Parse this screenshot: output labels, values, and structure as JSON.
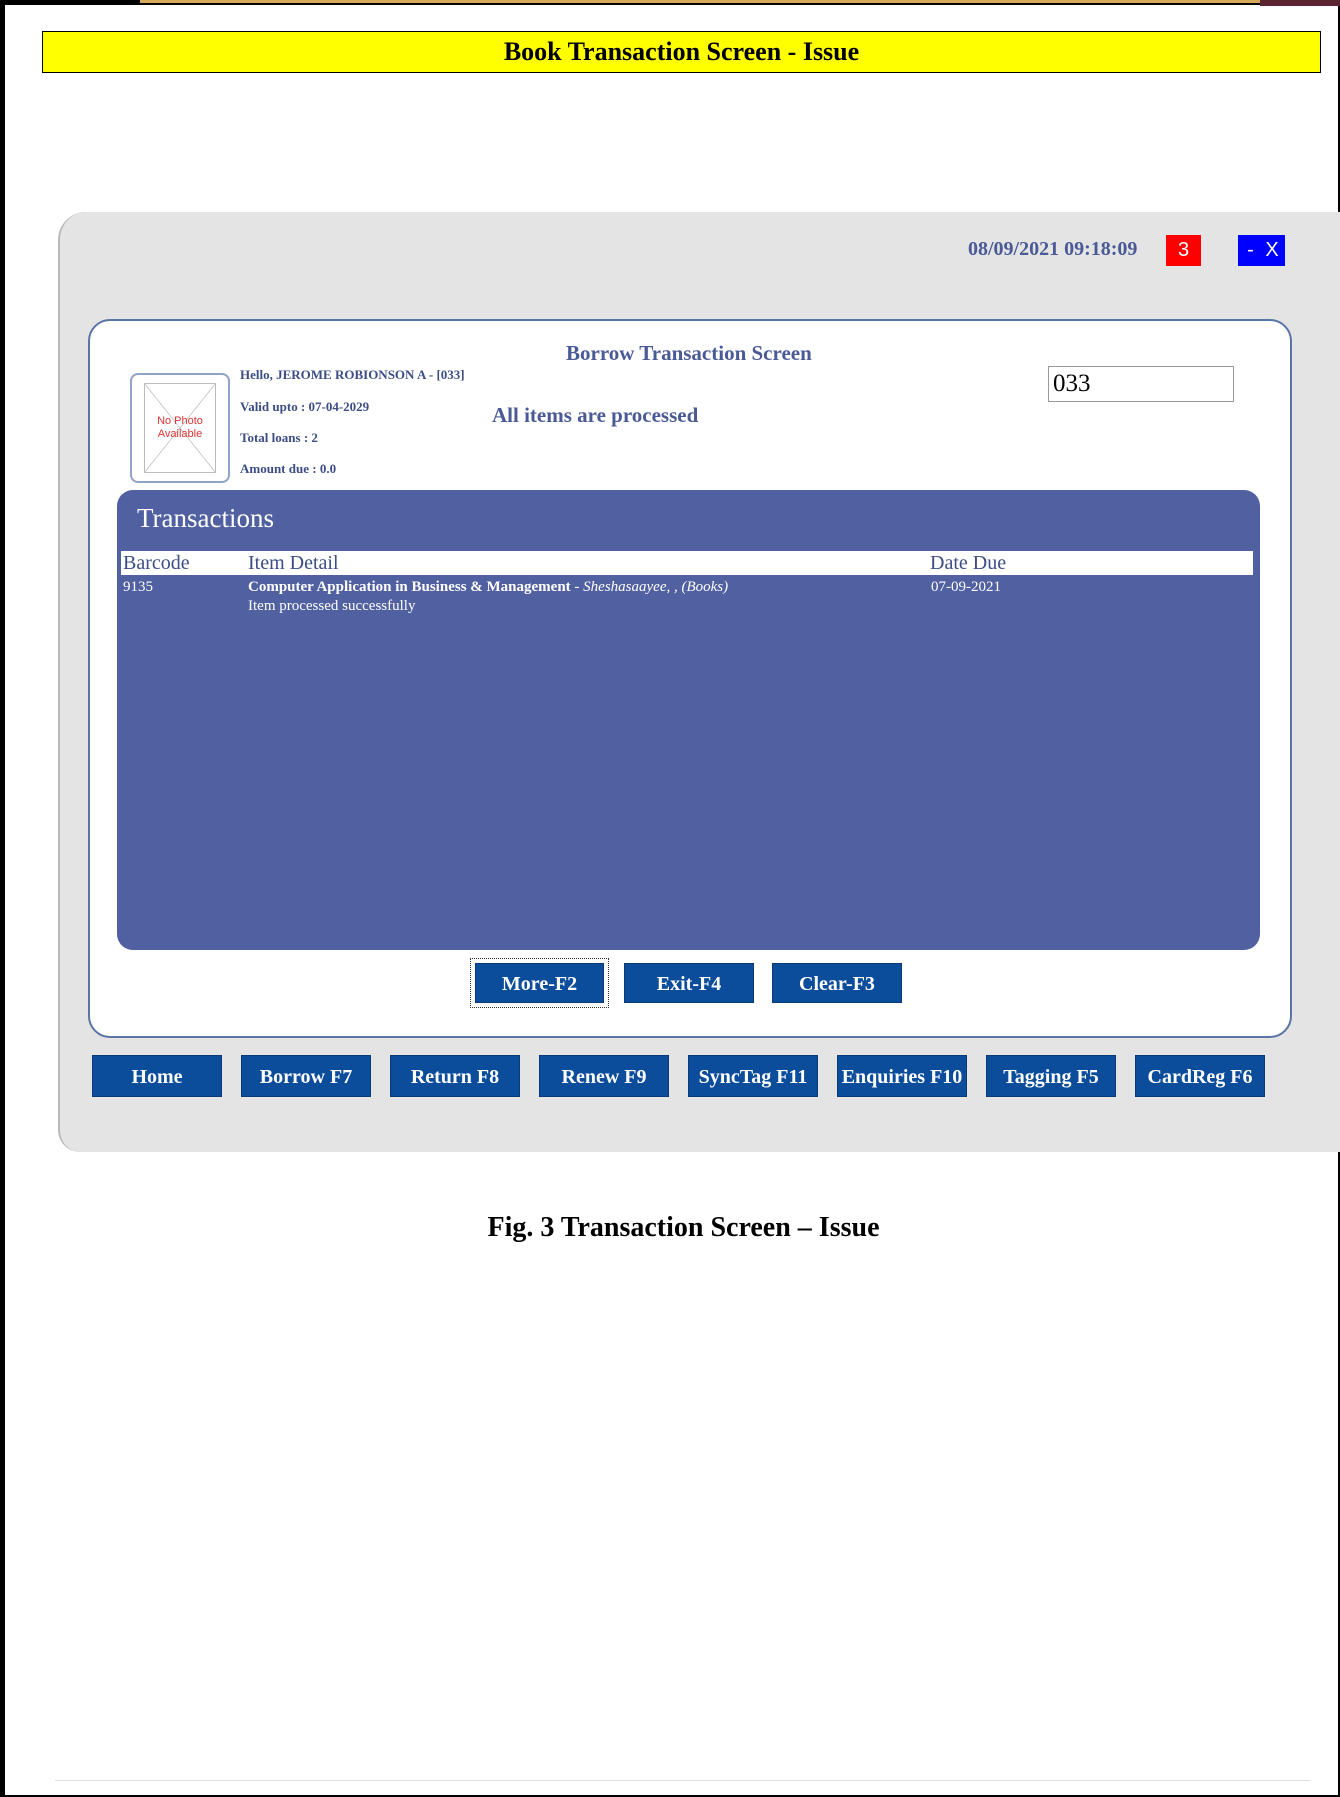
{
  "banner": "Book Transaction Screen - Issue",
  "window": {
    "datetime": "08/09/2021 09:18:09",
    "badge": "3",
    "minimize_label": "-",
    "close_label": "X"
  },
  "screen_title": "Borrow Transaction Screen",
  "patron": {
    "photo_text_line1": "No Photo",
    "photo_text_line2": "Available",
    "greeting": "Hello, JEROME ROBIONSON A - [033]",
    "valid_upto": "Valid upto : 07-04-2029",
    "total_loans": "Total loans : 2",
    "amount_due": "Amount due : 0.0"
  },
  "status_message": "All items are processed",
  "card_input": {
    "value": "033"
  },
  "transactions": {
    "title": "Transactions",
    "columns": [
      "Barcode",
      "Item Detail",
      "Date Due"
    ],
    "rows": [
      {
        "barcode": "9135",
        "title": "Computer Application in Business & Management",
        "separator": " - ",
        "author_type": "Sheshasaayee, , (Books)",
        "note": "Item processed successfully",
        "date_due": "07-09-2021"
      }
    ]
  },
  "actions": [
    "More-F2",
    "Exit-F4",
    "Clear-F3"
  ],
  "nav": [
    "Home",
    "Borrow F7",
    "Return F8",
    "Renew F9",
    "SyncTag F11",
    "Enquiries F10",
    "Tagging F5",
    "CardReg F6"
  ],
  "caption": "Fig. 3 Transaction Screen – Issue",
  "colors": {
    "banner_bg": "#ffff00",
    "accent_text": "#4a5a96",
    "transactions_bg": "#5160a0",
    "button_bg": "#0b4c9b",
    "badge_bg": "#ff0000",
    "window_button_bg": "#0000ff"
  }
}
